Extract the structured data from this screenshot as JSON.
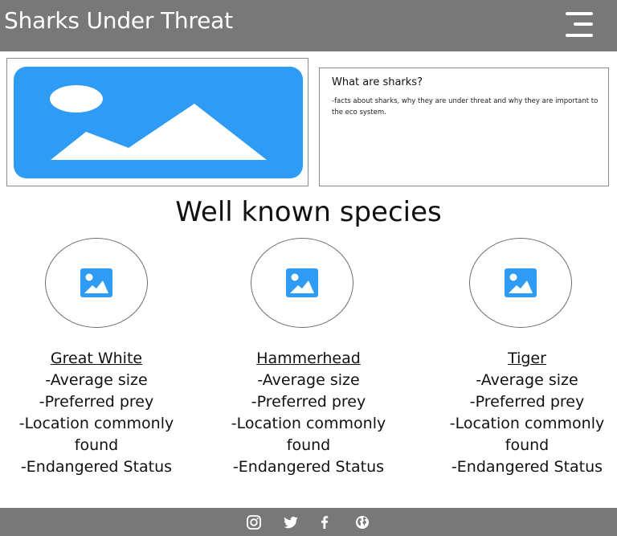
{
  "header": {
    "title": "Sharks Under Threat",
    "menu_icon": "hamburger-menu-icon"
  },
  "hero": {
    "image_icon": "image-placeholder-icon"
  },
  "info": {
    "title": "What are sharks?",
    "text": "-facts about sharks, why they are under threat and why they are important to the eco system."
  },
  "section": {
    "title": "Well known species"
  },
  "species": [
    {
      "name": "Great White",
      "lines": [
        "-Average size",
        "-Preferred prey",
        "-Location commonly found",
        "-Endangered Status"
      ]
    },
    {
      "name": "Hammerhead",
      "lines": [
        "-Average size",
        "-Preferred prey",
        "-Location commonly found",
        "-Endangered Status"
      ]
    },
    {
      "name": "Tiger",
      "lines": [
        "-Average size",
        "-Preferred prey",
        "-Location commonly found",
        "-Endangered Status"
      ]
    }
  ],
  "footer": {
    "icons": [
      "instagram-icon",
      "twitter-icon",
      "facebook-icon",
      "globe-icon"
    ]
  },
  "colors": {
    "header_bg": "#787878",
    "footer_bg": "#787878",
    "image_blue": "#2e9bf5"
  }
}
